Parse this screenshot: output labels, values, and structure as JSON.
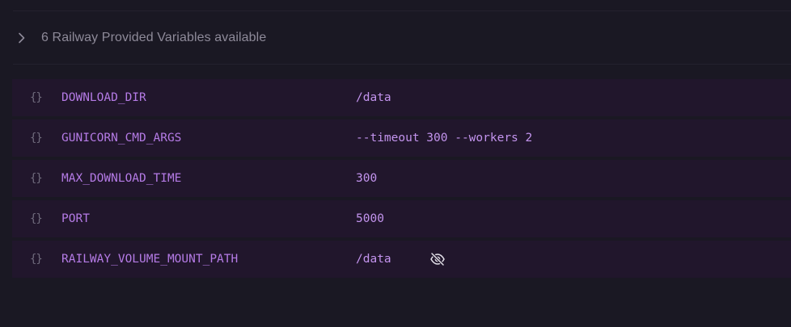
{
  "provided": {
    "label": "6 Railway Provided Variables available"
  },
  "variables": [
    {
      "icon": "{}",
      "name": "DOWNLOAD_DIR",
      "value": "/data"
    },
    {
      "icon": "{}",
      "name": "GUNICORN_CMD_ARGS",
      "value": "--timeout 300 --workers 2"
    },
    {
      "icon": "{}",
      "name": "MAX_DOWNLOAD_TIME",
      "value": "300"
    },
    {
      "icon": "{}",
      "name": "PORT",
      "value": "5000"
    },
    {
      "icon": "{}",
      "name": "RAILWAY_VOLUME_MOUNT_PATH",
      "value": "/data"
    }
  ],
  "icons": {
    "expand": "chevron-right-icon",
    "variable": "braces-icon",
    "hide": "eye-off-icon"
  },
  "colors": {
    "background": "#1a1823",
    "row_background": "#21162c",
    "name_text": "#b57be6",
    "value_text": "#c394ee",
    "muted_text": "#8e8a99"
  }
}
